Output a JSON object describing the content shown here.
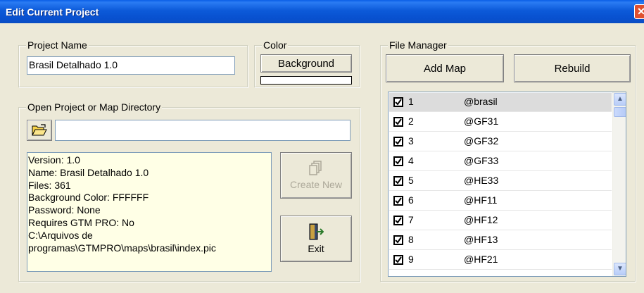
{
  "window": {
    "title": "Edit Current Project",
    "close_label": "✕"
  },
  "project_name": {
    "label": "Project Name",
    "value": "Brasil Detalhado 1.0"
  },
  "color": {
    "label": "Color",
    "background_button": "Background",
    "swatch_color": "#FFFFFF"
  },
  "open_dir": {
    "label": "Open Project or Map Directory",
    "path_value": ""
  },
  "info": {
    "lines": [
      "Version: 1.0",
      "Name: Brasil Detalhado 1.0",
      "Files: 361",
      "Background Color: FFFFFF",
      "Password: None",
      "Requires GTM PRO: No",
      "C:\\Arquivos de",
      "programas\\GTMPRO\\maps\\brasil\\index.pic"
    ]
  },
  "buttons": {
    "create_new": "Create New",
    "exit": "Exit"
  },
  "file_manager": {
    "label": "File Manager",
    "add_map": "Add Map",
    "rebuild": "Rebuild",
    "rows": [
      {
        "num": "1",
        "name": "@brasil",
        "checked": true
      },
      {
        "num": "2",
        "name": "@GF31",
        "checked": true
      },
      {
        "num": "3",
        "name": "@GF32",
        "checked": true
      },
      {
        "num": "4",
        "name": "@GF33",
        "checked": true
      },
      {
        "num": "5",
        "name": "@HE33",
        "checked": true
      },
      {
        "num": "6",
        "name": "@HF11",
        "checked": true
      },
      {
        "num": "7",
        "name": "@HF12",
        "checked": true
      },
      {
        "num": "8",
        "name": "@HF13",
        "checked": true
      },
      {
        "num": "9",
        "name": "@HF21",
        "checked": true
      }
    ]
  }
}
